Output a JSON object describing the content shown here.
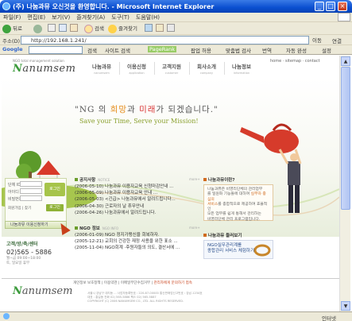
{
  "window": {
    "title": "(주) 나눔과뮤 오신것을 환영합니다. - Microsoft Internet Explorer",
    "controls": [
      "_",
      "□",
      "×"
    ]
  },
  "menubar": {
    "items": [
      "파일(F)",
      "편집(E)",
      "보기(V)",
      "즐겨찾기(A)",
      "도구(T)",
      "도움말(H)"
    ]
  },
  "toolbar": {
    "back": "뒤로",
    "search": "검색",
    "favorites": "즐겨찾기"
  },
  "address": {
    "label": "주소(D)",
    "url": "http://192.168.1.241/",
    "go": "이동",
    "links": "연결"
  },
  "googlebar": {
    "brand": "Google",
    "search_btn": "검색",
    "site_search": "사이트 검색",
    "pagerank": "PageRank",
    "popup": "팝업 허용",
    "spell": "맞춤법 검사",
    "translate": "번역",
    "autofill": "자동 완성",
    "settings": "설정"
  },
  "site": {
    "logo_small": "NGO total management solution",
    "logo": "anumsem",
    "nav": [
      {
        "label": "나눔과뮤",
        "sub": "nanumsem"
      },
      {
        "label": "이용신청",
        "sub": "application"
      },
      {
        "label": "고객지원",
        "sub": "customer"
      },
      {
        "label": "회사소개",
        "sub": "company"
      },
      {
        "label": "나눔정보",
        "sub": "information"
      }
    ],
    "toplinks": "home  ·  sitemap  ·  contact",
    "slogan_pre": "\"NG  의 ",
    "slogan_hope": "희망",
    "slogan_mid": "과 ",
    "slogan_future": "미래",
    "slogan_post": "가 되겠습니다.\"",
    "slogan_en": "Save your Time, Serve your Mission!",
    "login": {
      "id_label": "단체 ID",
      "user_label": "아이디",
      "pw_label": "비밀번호",
      "login_btn": "로그인",
      "links": "회원가입 | 찾기",
      "ok": "로그인"
    },
    "guide_btn": "나눔과뮤 이용신청하기",
    "contact": {
      "title": "고객/방/축/센터",
      "phone": "02)565 - 5886",
      "hours1": "월~금 09:00~18:00",
      "hours2": "토, 일요일 휴무"
    },
    "notice": {
      "title": "공지사항",
      "en": "NOTICE",
      "more": "more+",
      "items": [
        "(2006-05-10) 나눔과뮤 이용자교육 신청마감안내 ...",
        "(2006-05-09) 나눔과뮤 이용자교육 안내 ...",
        "(2006-05-03) <긴급> 나눔과뮤에서 알려드립니다...",
        "(2006-04-30) 근로자의 날 휴무안내",
        "(2006-04-26) 나눔과뮤에서 알려드립니다."
      ]
    },
    "ngo": {
      "title": "NGO 정보",
      "en": "NGO INFO",
      "more": "more+",
      "items": [
        "(2006-01-09) NGO 정지가맹신을 회복하자.",
        "(2005-12-21) 교회의 건강한 재정 사용을 위한 표소 ...",
        "(2005-11-04) NGO회계 ·후원자들의 의도, 결산서에 ..."
      ]
    },
    "about": {
      "title": "나눔과뮤이란?",
      "text1": "나눔과뮤은 비영리단체의 관리업무",
      "text2": "를 일원화 기능들에 대하여 ",
      "hl1": "실무자 중심의",
      "text3": "서비스",
      "text4": "를 종합적으로 제공하여 효율적인",
      "text5": "모든 업무를 쉽게 통해서 관리하는",
      "text6": "비영리단체 관리 프로그램입니다."
    },
    "guide": {
      "title": "나눔과뮤 둘러보기",
      "line1": "NGO실무관리계를",
      "line2": "종합관리 서비스 체험하기"
    },
    "footer": {
      "links": "개인정보 보호정책   |   이용약관   |   이메일무단수집거부   |   ",
      "links_hl": "관리자에게 문의하기 접속",
      "info1": "서울시 강남구 대치동 ... 사업자등록번호 : 220-87-00000   통신판매업신고번호 : 강남-1234호",
      "info2": "대표 : 홍길동   전화 02) 565-5886   팩스 02) 565-5887",
      "info3": "COPYRIGHT (C) 2006 NANUMSEM CO., LTD. ALL RIGHTS RESERVED."
    }
  },
  "status": {
    "zone": "인터넷"
  }
}
